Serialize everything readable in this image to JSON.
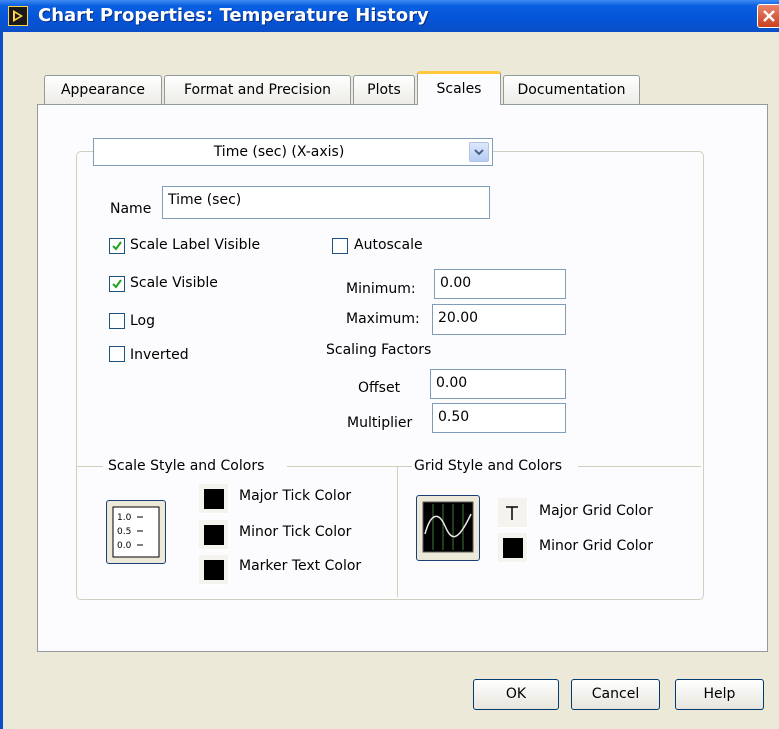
{
  "window": {
    "title": "Chart Properties: Temperature History"
  },
  "tabs": [
    {
      "label": "Appearance",
      "active": false
    },
    {
      "label": "Format and Precision",
      "active": false
    },
    {
      "label": "Plots",
      "active": false
    },
    {
      "label": "Scales",
      "active": true
    },
    {
      "label": "Documentation",
      "active": false
    }
  ],
  "scale": {
    "axis_selected": "Time (sec) (X-axis)",
    "name_label": "Name",
    "name_value": "Time (sec)",
    "checkboxes": {
      "scale_label_visible": {
        "label": "Scale Label Visible",
        "checked": true
      },
      "scale_visible": {
        "label": "Scale Visible",
        "checked": true
      },
      "log": {
        "label": "Log",
        "checked": false
      },
      "inverted": {
        "label": "Inverted",
        "checked": false
      },
      "autoscale": {
        "label": "Autoscale",
        "checked": false
      }
    },
    "minimum_label": "Minimum:",
    "minimum_value": "0.00",
    "maximum_label": "Maximum:",
    "maximum_value": "20.00",
    "scaling_factors_label": "Scaling Factors",
    "offset_label": "Offset",
    "offset_value": "0.00",
    "multiplier_label": "Multiplier",
    "multiplier_value": "0.50"
  },
  "scale_style": {
    "title": "Scale Style and Colors",
    "icon_ticks": [
      "1.0",
      "0.5",
      "0.0"
    ],
    "major_tick_label": "Major Tick Color",
    "minor_tick_label": "Minor Tick Color",
    "marker_text_label": "Marker Text Color",
    "major_tick_color": "#000000",
    "minor_tick_color": "#000000",
    "marker_text_color": "#000000"
  },
  "grid_style": {
    "title": "Grid Style and Colors",
    "major_grid_label": "Major Grid Color",
    "minor_grid_label": "Minor Grid Color",
    "major_grid_color": "transparent",
    "minor_grid_color": "#000000"
  },
  "buttons": {
    "ok": "OK",
    "cancel": "Cancel",
    "help": "Help"
  }
}
